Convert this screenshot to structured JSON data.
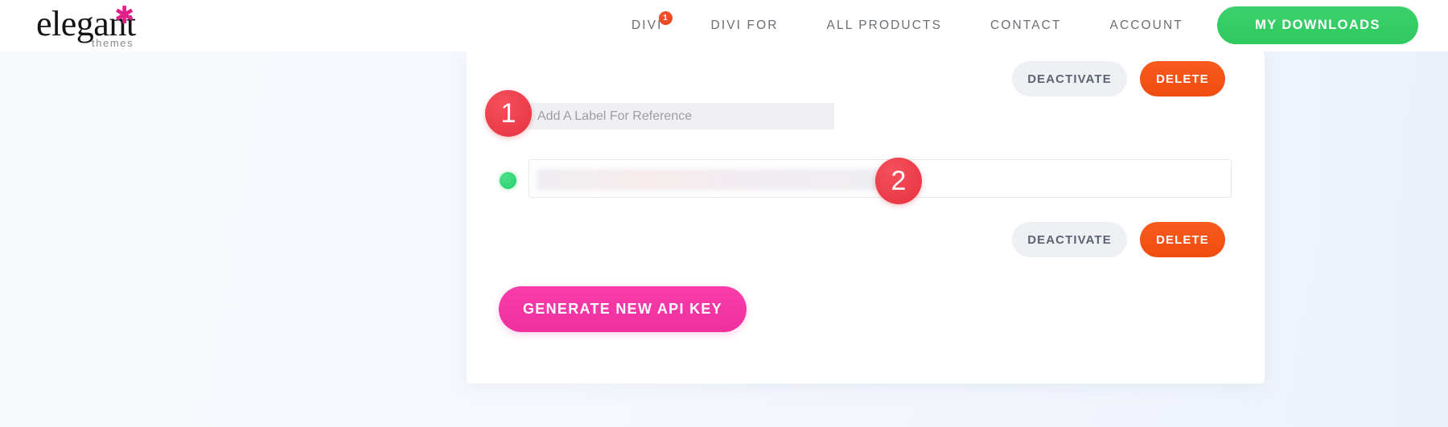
{
  "header": {
    "logo": {
      "word": "elegant",
      "star_icon": "asterisk-icon",
      "sub": "themes"
    },
    "nav_items": [
      {
        "label": "DIVI",
        "badge": "1"
      },
      {
        "label": "DIVI FOR",
        "badge": null
      },
      {
        "label": "ALL PRODUCTS",
        "badge": null
      },
      {
        "label": "CONTACT",
        "badge": null
      },
      {
        "label": "ACCOUNT",
        "badge": null
      }
    ],
    "downloads_button": "MY DOWNLOADS"
  },
  "card": {
    "top_actions": {
      "deactivate": "DEACTIVATE",
      "delete": "DELETE"
    },
    "label_field": {
      "value": "",
      "placeholder": "Add A Label For Reference"
    },
    "api_key_row": {
      "status": "active",
      "key_value": ""
    },
    "bottom_actions": {
      "deactivate": "DEACTIVATE",
      "delete": "DELETE"
    },
    "generate_button": "GENERATE NEW API KEY"
  },
  "annotations": {
    "markers": [
      {
        "number": "1"
      },
      {
        "number": "2"
      }
    ]
  },
  "colors": {
    "brand_pink": "#ef2f9e",
    "accent_green": "#2fc95f",
    "danger_orange": "#f04d10",
    "marker_red": "#e8313f",
    "status_green": "#23cf68",
    "logo_star_pink": "#e0218a"
  }
}
